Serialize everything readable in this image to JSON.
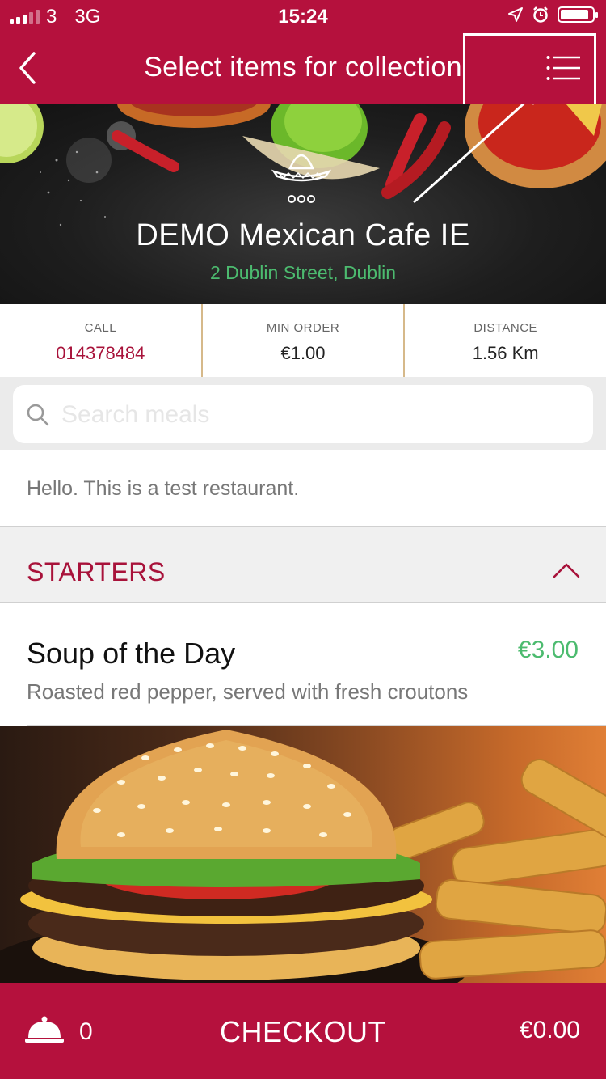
{
  "status_bar": {
    "carrier": "3",
    "network": "3G",
    "time": "15:24"
  },
  "nav": {
    "title": "Select items for collection",
    "back_icon": "chevron-left-icon",
    "menu_icon": "list-menu-icon"
  },
  "restaurant": {
    "name": "DEMO Mexican Cafe IE",
    "address": "2 Dublin Street, Dublin"
  },
  "info": {
    "call_label": "CALL",
    "call_value": "014378484",
    "min_order_label": "MIN ORDER",
    "min_order_value": "€1.00",
    "distance_label": "DISTANCE",
    "distance_value": "1.56 Km"
  },
  "search": {
    "placeholder": "Search meals",
    "value": ""
  },
  "welcome_message": "Hello. This is a test restaurant.",
  "menu": {
    "category": "STARTERS",
    "items": [
      {
        "name": "Soup of the Day",
        "price": "€3.00",
        "description": "Roasted red pepper, served with fresh croutons"
      }
    ]
  },
  "bottom_bar": {
    "cart_count": "0",
    "checkout_label": "CHECKOUT",
    "total": "€0.00"
  },
  "colors": {
    "brand": "#b5113d",
    "price_green": "#4cbb6f",
    "divider_gold": "#d6b98a"
  }
}
